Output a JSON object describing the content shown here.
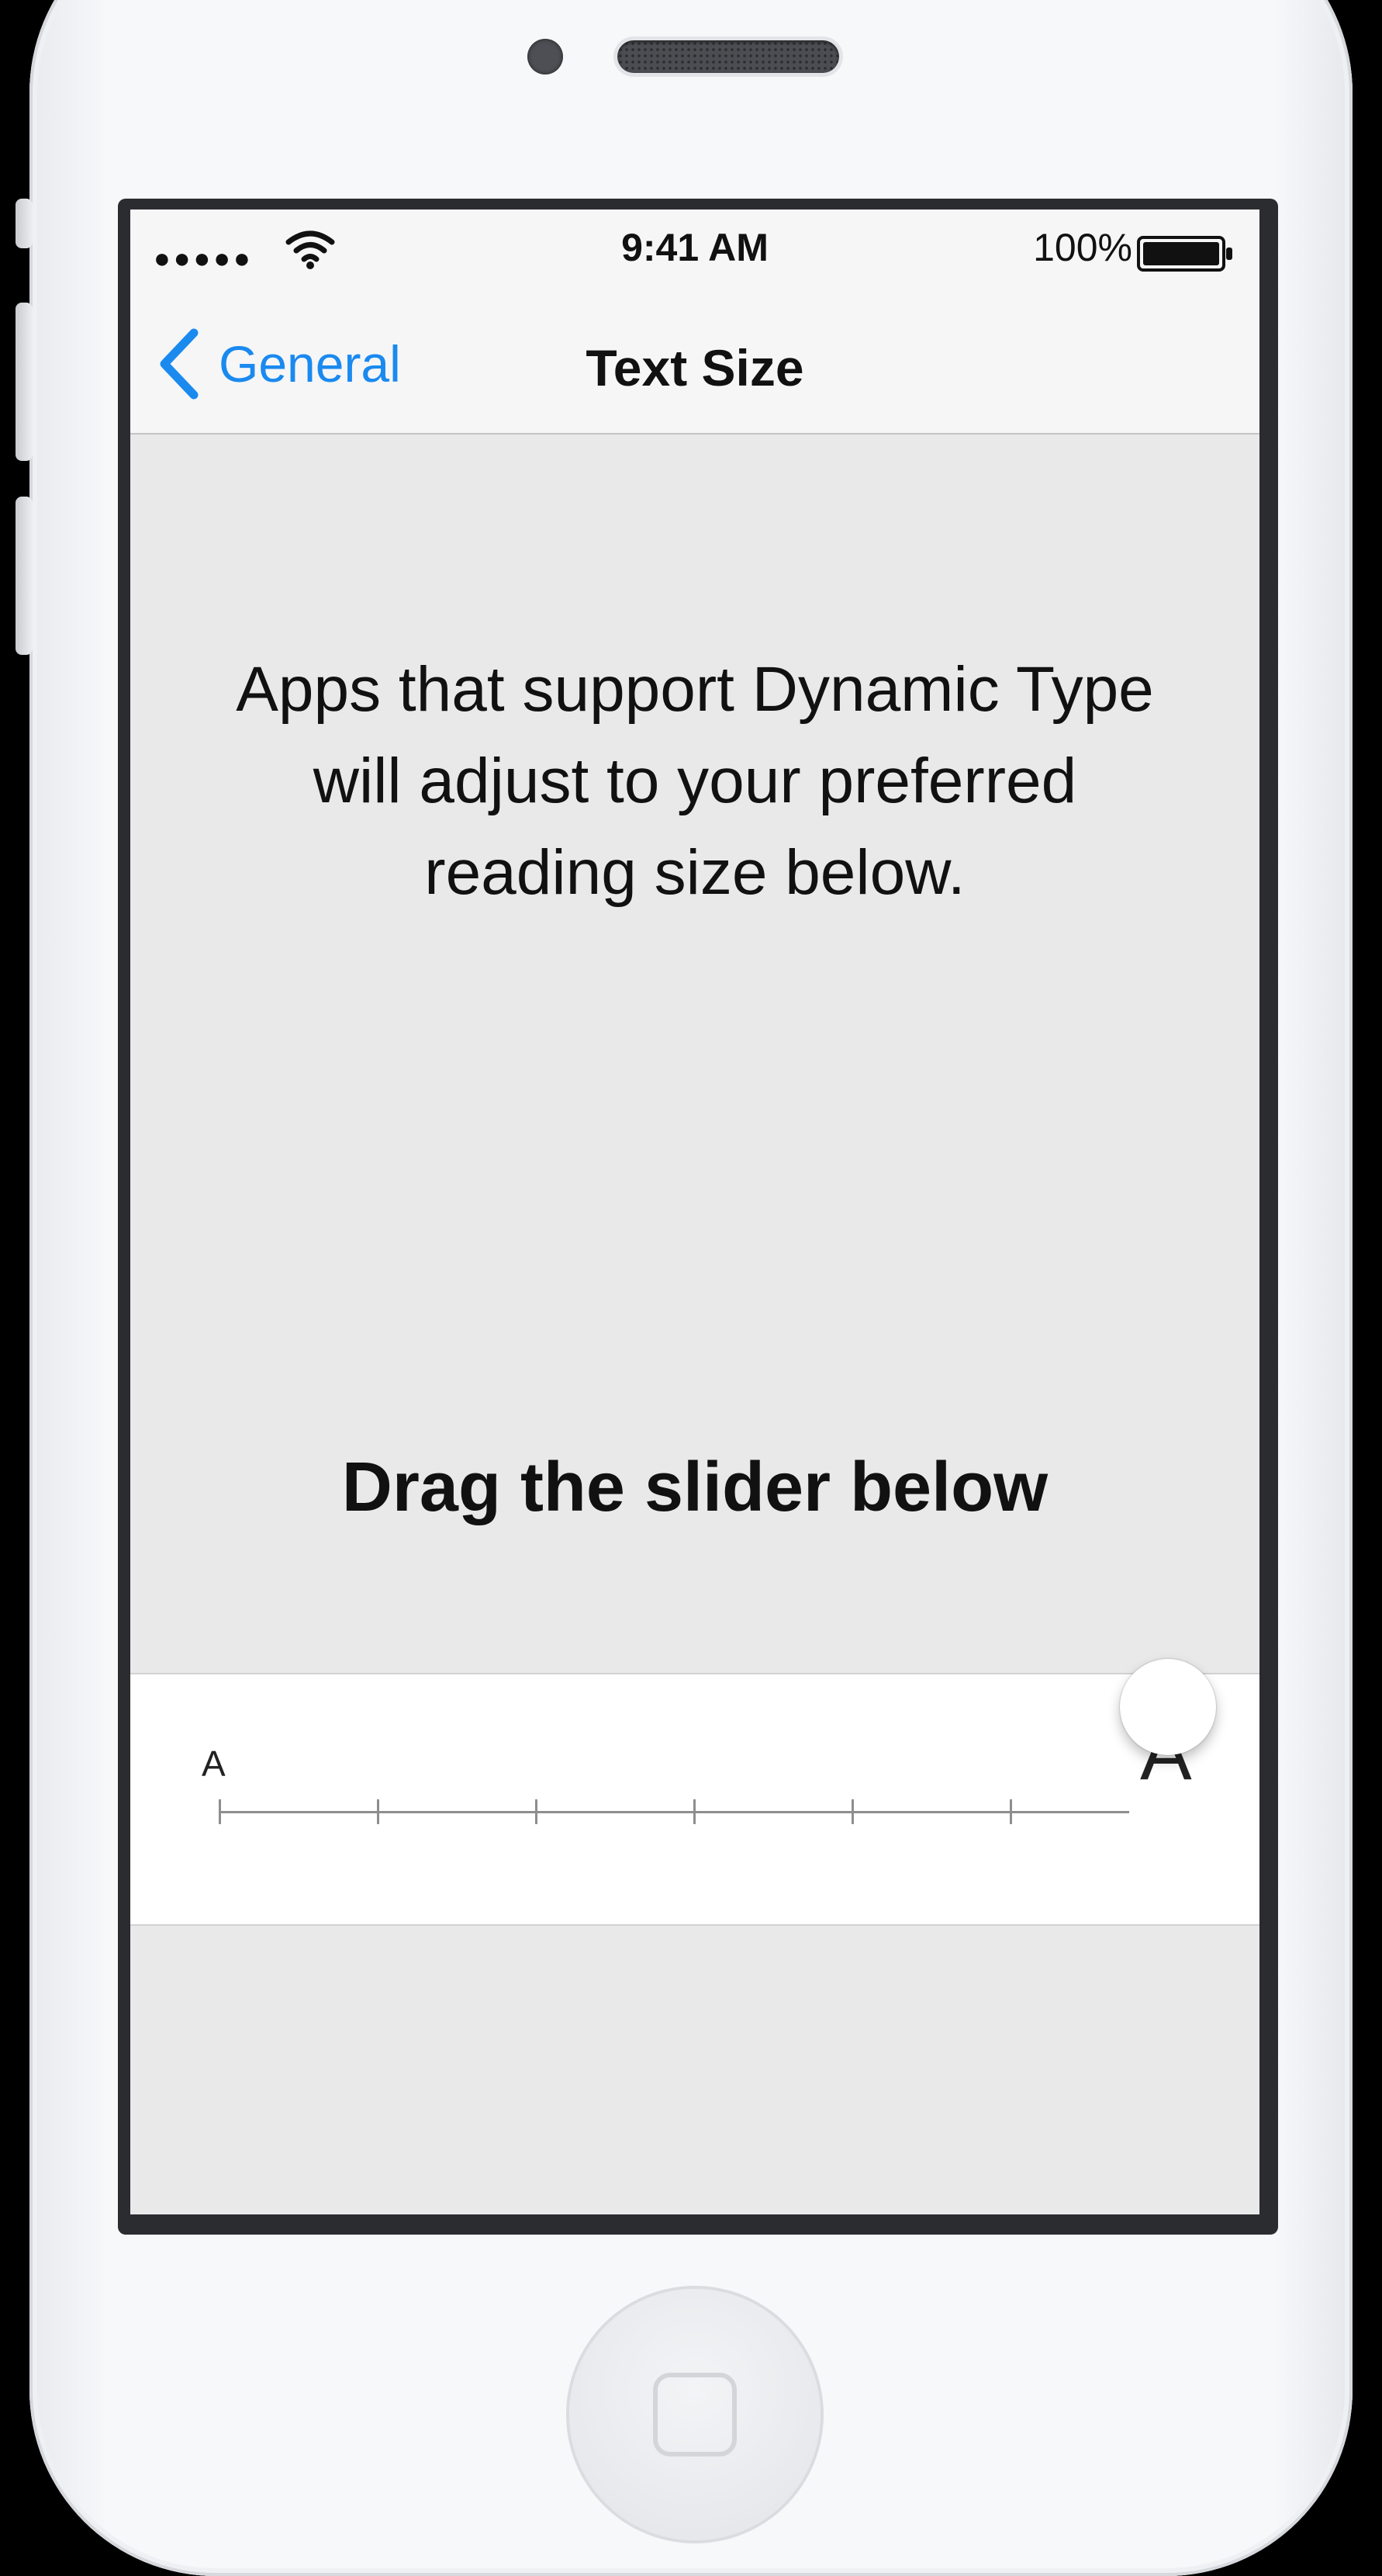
{
  "status_bar": {
    "signal": "●●●●●",
    "time": "9:41 AM",
    "battery": "100%"
  },
  "nav": {
    "back_label": "General",
    "title": "Text Size"
  },
  "content": {
    "description": "Apps that support Dynamic Type will adjust to your preferred reading size below.",
    "drag_hint": "Drag the slider below"
  },
  "slider": {
    "min_label": "A",
    "max_label": "A",
    "steps": 7,
    "value": 7
  },
  "colors": {
    "accent": "#1a8aef",
    "screen_bg": "#e9e9ea",
    "bar_bg": "#f6f6f7"
  },
  "icons": {
    "wifi": "wifi-icon",
    "battery": "battery-icon",
    "back": "chevron-left-icon"
  }
}
